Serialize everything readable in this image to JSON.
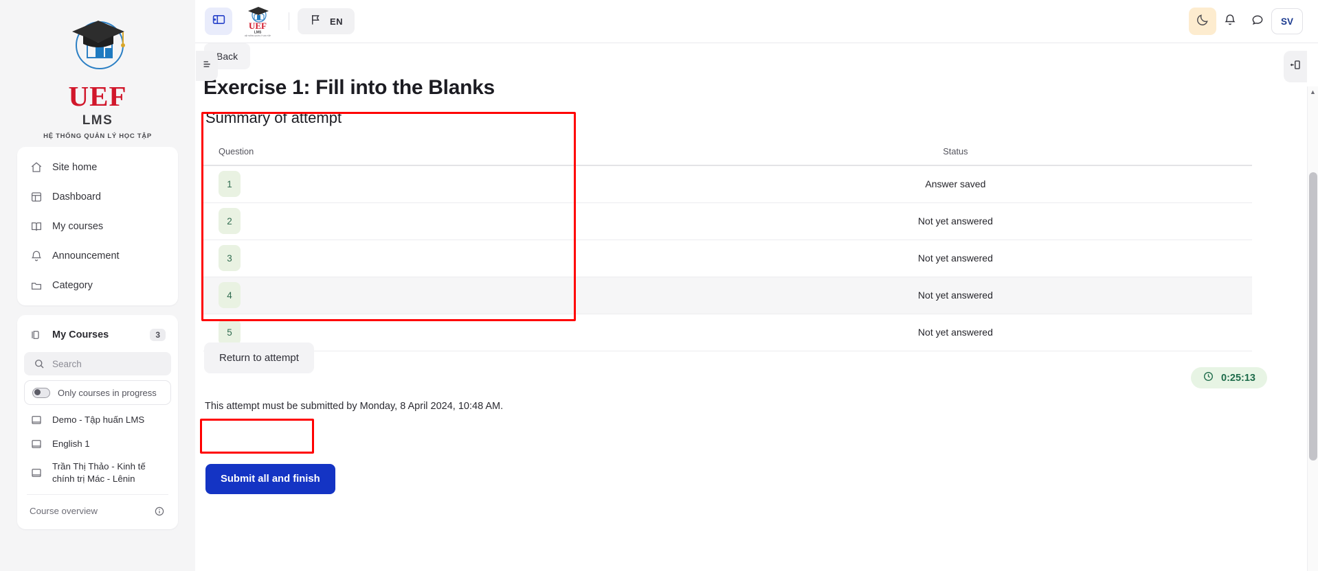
{
  "brand": {
    "name": "UEF",
    "system": "LMS",
    "tagline": "HỆ THỐNG QUẢN LÝ HỌC TẬP"
  },
  "topbar": {
    "sidebar_toggle_icon": "panel-collapse-icon",
    "lang_icon": "flag-icon",
    "lang_label": "EN",
    "theme_icon": "moon-icon",
    "notifications_icon": "bell-icon",
    "messages_icon": "chat-icon",
    "avatar_initials": "SV"
  },
  "sidebar": {
    "nav": [
      {
        "label": "Site home",
        "icon": "home-icon"
      },
      {
        "label": "Dashboard",
        "icon": "dashboard-icon"
      },
      {
        "label": "My courses",
        "icon": "book-open-icon"
      },
      {
        "label": "Announcement",
        "icon": "bell-icon"
      },
      {
        "label": "Category",
        "icon": "folder-icon"
      }
    ],
    "my_courses": {
      "title": "My Courses",
      "icon": "courses-icon",
      "count": "3",
      "search_placeholder": "Search",
      "search_value": "",
      "search_icon": "search-icon",
      "filter_label": "Only courses in progress",
      "courses": [
        {
          "label": "Demo - Tập huấn LMS",
          "icon": "book-icon"
        },
        {
          "label": "English 1",
          "icon": "book-icon"
        },
        {
          "label": "Trần Thị Thảo - Kinh tế chính trị Mác - Lênin",
          "icon": "book-icon"
        }
      ],
      "overview_label": "Course overview",
      "overview_icon": "info-icon"
    }
  },
  "main": {
    "back_label": "Back",
    "page_title": "Exercise 1: Fill into the Blanks",
    "section_title": "Summary of attempt",
    "table": {
      "columns": [
        "Question",
        "Status"
      ],
      "rows": [
        {
          "question": "1",
          "status": "Answer saved"
        },
        {
          "question": "2",
          "status": "Not yet answered"
        },
        {
          "question": "3",
          "status": "Not yet answered"
        },
        {
          "question": "4",
          "status": "Not yet answered"
        },
        {
          "question": "5",
          "status": "Not yet answered"
        }
      ]
    },
    "return_label": "Return to attempt",
    "timer": {
      "icon": "clock-icon",
      "value": "0:25:13"
    },
    "deadline_text": "This attempt must be submitted by Monday, 8 April 2024, 10:48 AM.",
    "submit_label": "Submit all and finish"
  },
  "drawers": {
    "left_icon": "drawer-open-left-icon",
    "right_icon": "drawer-open-right-icon"
  },
  "colors": {
    "brand_red": "#d1172b",
    "submit_blue": "#1434c4",
    "annotation_red": "#ff0000",
    "timer_green": "#1d6b4a",
    "qnum_green_bg": "#e9f2e2"
  }
}
